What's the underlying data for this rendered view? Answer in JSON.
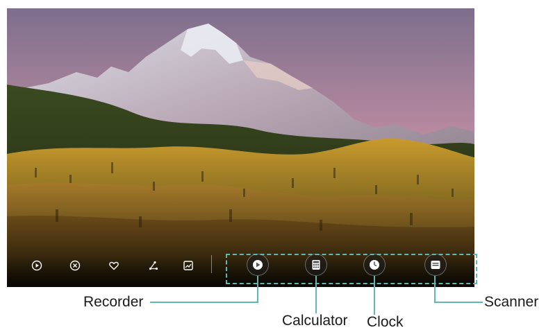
{
  "toolbar": {
    "left_icons": [
      "play-circle-icon",
      "close-circle-icon",
      "heart-icon",
      "share-icon",
      "edit-image-icon"
    ],
    "apps": [
      {
        "name": "Recorder",
        "icon": "recorder-icon"
      },
      {
        "name": "Calculator",
        "icon": "calculator-icon"
      },
      {
        "name": "Clock",
        "icon": "clock-icon"
      },
      {
        "name": "Scanner",
        "icon": "scanner-icon"
      }
    ]
  },
  "callouts": {
    "recorder": "Recorder",
    "calculator": "Calculator",
    "clock": "Clock",
    "scanner": "Scanner"
  },
  "colors": {
    "callout_line": "#5fb8b5",
    "highlight_border": "#5fb8b5",
    "icon_white": "#ffffff"
  }
}
